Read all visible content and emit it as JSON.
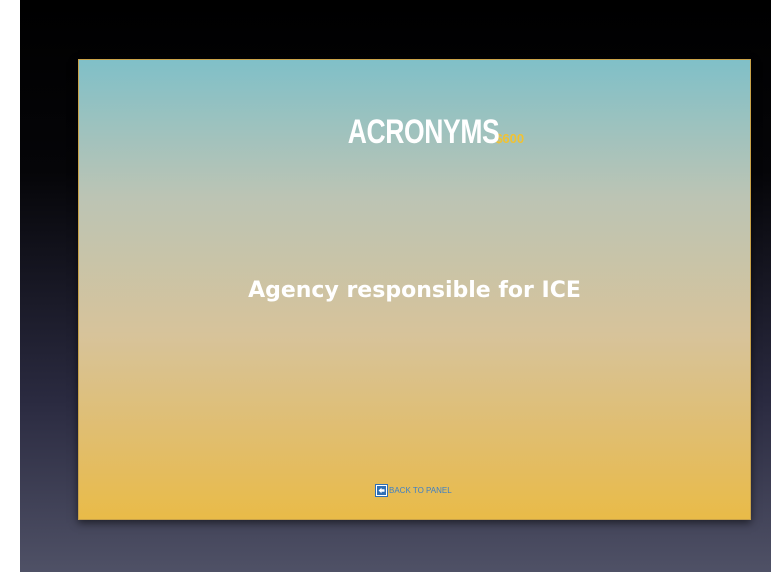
{
  "slide": {
    "category": "ACRONYMS",
    "separator": "-",
    "price": "$600",
    "question": "Agency responsible for ICE",
    "back_link_label": "BACK TO PANEL",
    "back_icon": "back-arrow-icon"
  },
  "colors": {
    "gradient_top": "#80c0c8",
    "gradient_bottom": "#e9bb48",
    "title_text": "#ffffff",
    "price_text": "#f1c232",
    "link_text": "#3d7fc6",
    "background_top": "#000000",
    "background_bottom": "#4f5166"
  }
}
